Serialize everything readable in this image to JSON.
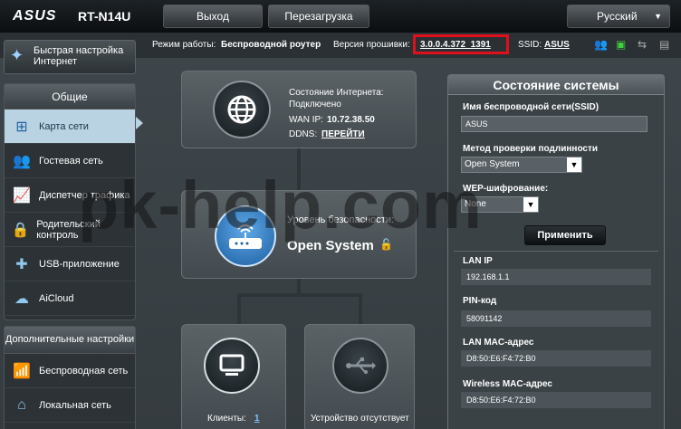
{
  "header": {
    "brand": "ASUS",
    "model": "RT-N14U",
    "logout": "Выход",
    "reboot": "Перезагрузка",
    "language": "Русский"
  },
  "status_line": {
    "mode_label": "Режим работы:",
    "mode_value": "Беспроводной роутер",
    "fw_label": "Версия прошивки:",
    "fw_value": "3.0.0.4.372_1391",
    "ssid_label": "SSID:",
    "ssid_value": "ASUS"
  },
  "sidebar": {
    "quick": "Быстрая настройка Интернет",
    "group1_title": "Общие",
    "group1_items": [
      "Карта сети",
      "Гостевая сеть",
      "Диспетчер трафика",
      "Родительский контроль",
      "USB-приложение",
      "AiCloud"
    ],
    "group2_title": "Дополнительные настройки",
    "group2_items": [
      "Беспроводная сеть",
      "Локальная сеть"
    ]
  },
  "map": {
    "inet_status_label": "Состояние Интернета:",
    "inet_status": "Подключено",
    "wan_ip_label": "WAN IP:",
    "wan_ip": "10.72.38.50",
    "ddns_label": "DDNS:",
    "ddns_link": "ПЕРЕЙТИ",
    "security_label": "Уровень безопасности:",
    "security_value": "Open System",
    "clients_label": "Клиенты:",
    "clients_count": "1",
    "usb_label": "Устройство отсутствует"
  },
  "panel": {
    "title": "Состояние системы",
    "ssid_label": "Имя беспроводной сети(SSID)",
    "ssid_value": "ASUS",
    "auth_label": "Метод проверки подлинности",
    "auth_value": "Open System",
    "wep_label": "WEP-шифрование:",
    "wep_value": "None",
    "apply": "Применить",
    "lan_ip_label": "LAN IP",
    "lan_ip": "192.168.1.1",
    "pin_label": "PIN-код",
    "pin": "58091142",
    "lan_mac_label": "LAN MAC-адрес",
    "lan_mac": "D8:50:E6:F4:72:B0",
    "wl_mac_label": "Wireless MAC-адрес",
    "wl_mac": "D8:50:E6:F4:72:B0"
  },
  "watermark": "pk-help.com",
  "colors": {
    "highlight": "#e0101a",
    "active_item": "#b9d3e3"
  }
}
